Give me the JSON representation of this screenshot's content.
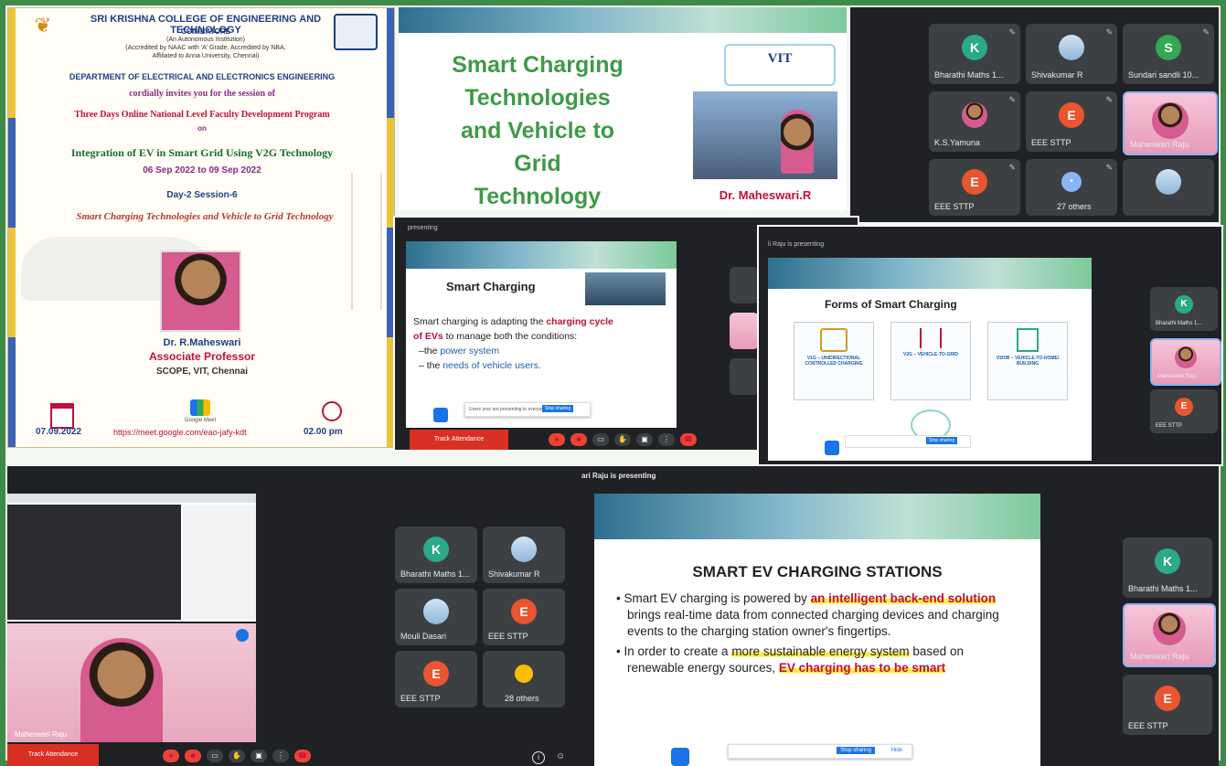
{
  "invite": {
    "college": "SRI KRISHNA COLLEGE OF ENGINEERING AND TECHNOLOGY",
    "city": "COIMBATORE",
    "autonomous": "(An Autonomous Institution)",
    "accreditation": "(Accredited by NAAC with 'A' Grade, Accredited by NBA,",
    "affiliation": "Affiliated to Anna University, Chennai)",
    "department": "DEPARTMENT OF ELECTRICAL  AND ELECTRONICS ENGINEERING",
    "invites": "cordially invites you for the session of",
    "program": "Three Days Online National Level  Faculty Development Program",
    "on": "on",
    "topic": "Integration of EV in Smart Grid Using V2G Technology",
    "dates": "06 Sep 2022  to 09 Sep 2022",
    "session": "Day-2 Session-6",
    "session_title": "Smart Charging Technologies and Vehicle to Grid Technology",
    "speaker": "Dr. R.Maheswari",
    "designation": "Associate Professor",
    "affil": "SCOPE, VIT, Chennai",
    "date": "07.09.2022",
    "link": "https://meet.google.com/eao-jafy-kdt",
    "time": "02.00 pm",
    "meet_label": "Google Meet"
  },
  "title_slide": {
    "title_lines": [
      "Smart Charging",
      "Technologies",
      "and  Vehicle to",
      "Grid",
      "Technology"
    ],
    "logo": "VIT",
    "presenter": "Dr. Maheswari.R"
  },
  "grid1": {
    "tiles": [
      {
        "name": "Bharathi Maths 1...",
        "kind": "logo"
      },
      {
        "name": "Shivakumar R",
        "kind": "photo"
      },
      {
        "name": "Sundari sandli 10...",
        "kind": "letter",
        "letter": "S"
      },
      {
        "name": "K.S.Yamuna",
        "kind": "photo"
      },
      {
        "name": "EEE STTP",
        "kind": "letter",
        "letter": "E"
      },
      {
        "name": "Maheswari Raju",
        "kind": "face"
      },
      {
        "name": "EEE STTP",
        "kind": "letter",
        "letter": "E"
      },
      {
        "name": "27 others",
        "kind": "others"
      },
      {
        "name": "",
        "kind": "photo"
      }
    ]
  },
  "slide_a": {
    "presenting": "presenting",
    "title": "Smart Charging",
    "line1_a": "Smart charging is adapting the ",
    "line1_b": "charging cycle",
    "line2_a": "of EVs",
    "line2_b": " to manage both the conditions:",
    "bullet1_a": "–the ",
    "bullet1_b": "power system",
    "bullet2_a": "– the ",
    "bullet2_b": "needs of vehicle users.",
    "attendance": "Track Attendance",
    "share_msg": "Users your are presenting to everyone",
    "stop": "Stop sharing"
  },
  "slide_b": {
    "presenting": "li Raju is presenting",
    "title": "Forms of Smart Charging",
    "card1": "V1G – UNIDIRECTIONAL CONTROLLED CHARGING",
    "card2": "V2G – VEHICLE-TO-GRID",
    "card3": "V2H/B – VEHICLE-TO-HOME/ BUILDING",
    "stop": "Stop sharing",
    "side_tiles": [
      "Bharathi Maths 1...",
      "Maheswari Raju",
      "EEE STTP"
    ]
  },
  "selfview": {
    "name": "Maheswari Raju",
    "attendance": "Track Attendance",
    "tiles": [
      {
        "name": "Bharathi Maths 1...",
        "kind": "logo"
      },
      {
        "name": "Shivakumar R",
        "kind": "photo"
      },
      {
        "name": "Mouli Dasari",
        "kind": "photo"
      },
      {
        "name": "EEE STTP",
        "kind": "letter",
        "letter": "E"
      },
      {
        "name": "EEE STTP",
        "kind": "letter",
        "letter": "E"
      },
      {
        "name": "28 others",
        "kind": "others"
      }
    ]
  },
  "slide_c": {
    "presenting": "ari Raju is presenting",
    "title": "SMART EV CHARGING STATIONS",
    "b1_a": "Smart EV charging is powered by ",
    "b1_b": "an intelligent back-end solution",
    "b1_c": " brings real-time data from connected charging devices and charging events to the charging station owner's fingertips.",
    "b2_a": "In order to create a ",
    "b2_b": "more sustainable energy system",
    "b2_c": " based on renewable energy sources, ",
    "b2_d": "EV charging has to be smart",
    "stop": "Stop sharing",
    "hide": "Hide",
    "side_tiles": [
      "Bharathi Maths 1...",
      "Maheswari Raju",
      "EEE STTP"
    ]
  },
  "colors": {
    "border": "#3e8a48",
    "meet_dark": "#202124",
    "accent_red": "#c0103a",
    "title_green": "#3f9a46"
  }
}
